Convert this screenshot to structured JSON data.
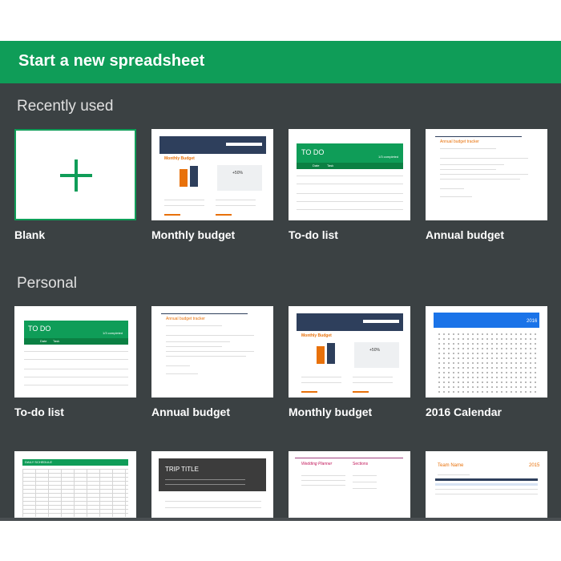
{
  "header": {
    "title": "Start a new spreadsheet"
  },
  "sections": {
    "recent": {
      "title": "Recently used"
    },
    "personal": {
      "title": "Personal"
    }
  },
  "recent_cards": [
    "Blank",
    "Monthly budget",
    "To-do list",
    "Annual budget"
  ],
  "personal_cards": [
    "To-do list",
    "Annual budget",
    "Monthly budget",
    "2016 Calendar"
  ],
  "thumb": {
    "monthly_title": "Monthly Budget",
    "monthly_pct": "+50%",
    "todo_header": "TO DO",
    "todo_completed": "1/3 completed",
    "todo_col_date": "Date",
    "todo_col_task": "Task",
    "annual_title": "Annual budget tracker",
    "cal_year": "2016",
    "trip_title": "TRIP TITLE",
    "wedding_title": "Wedding Planner",
    "wedding_sections": "Sections",
    "team_title": "Team Name",
    "team_year": "2015",
    "schedule_title": "DAILY SCHEDULE"
  },
  "colors": {
    "green": "#0f9d58",
    "panel": "#3b4143",
    "navy": "#2e3f5c",
    "orange": "#e8710a",
    "blue": "#1a73e8"
  }
}
